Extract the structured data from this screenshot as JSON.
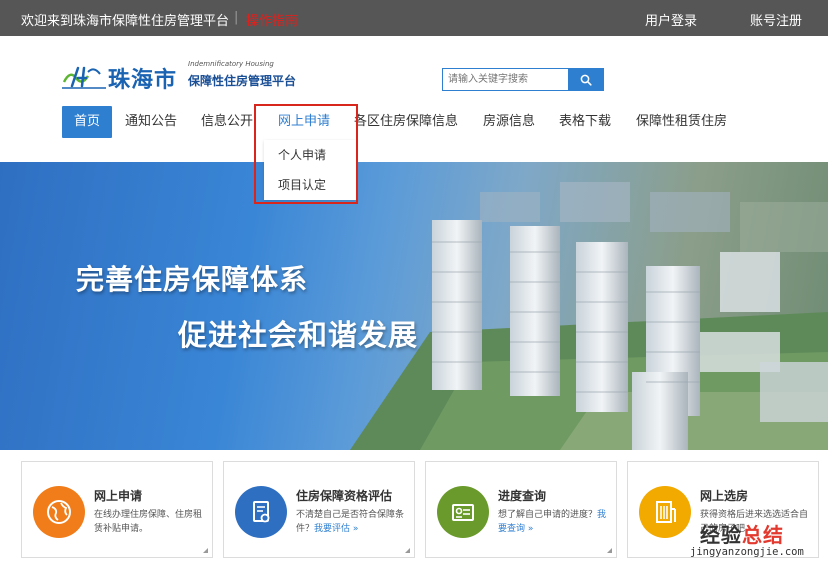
{
  "topbar": {
    "welcome": "欢迎来到珠海市保障性住房管理平台",
    "separator": "|",
    "red_link": "操作指南",
    "login": "用户登录",
    "register": "账号注册"
  },
  "logo": {
    "city": "珠海市",
    "en": "Indemnificatory Housing",
    "sub": "保障性住房管理平台"
  },
  "search": {
    "placeholder": "请输入关键字搜索"
  },
  "nav": {
    "items": [
      "首页",
      "通知公告",
      "信息公开",
      "网上申请",
      "各区住房保障信息",
      "房源信息",
      "表格下载",
      "保障性租赁住房"
    ]
  },
  "dropdown": {
    "items": [
      "个人申请",
      "项目认定"
    ]
  },
  "banner": {
    "slogan1": "完善住房保障体系",
    "slogan2": "促进社会和谐发展"
  },
  "cards": [
    {
      "title": "网上申请",
      "desc": "在线办理住房保障、住房租赁补贴申请。",
      "link": ""
    },
    {
      "title": "住房保障资格评估",
      "desc": "不清楚自己是否符合保障条件？",
      "link": "我要评估 »"
    },
    {
      "title": "进度查询",
      "desc": "想了解自己申请的进度？",
      "link": "我要查询 »"
    },
    {
      "title": "网上选房",
      "desc": "获得资格后进来选选适合自己的房子吧。",
      "link": ""
    }
  ],
  "colors": {
    "primary": "#2f7fd0",
    "highlight_box": "#d9261c",
    "card_icon_1": "#f07d1a",
    "card_icon_2": "#2f6fc2",
    "card_icon_3": "#6a9a2b",
    "card_icon_4": "#f2a900"
  },
  "watermark": {
    "cn_prefix": "经验",
    "cn_suffix": "总结",
    "url": "jingyanzongjie.com"
  }
}
